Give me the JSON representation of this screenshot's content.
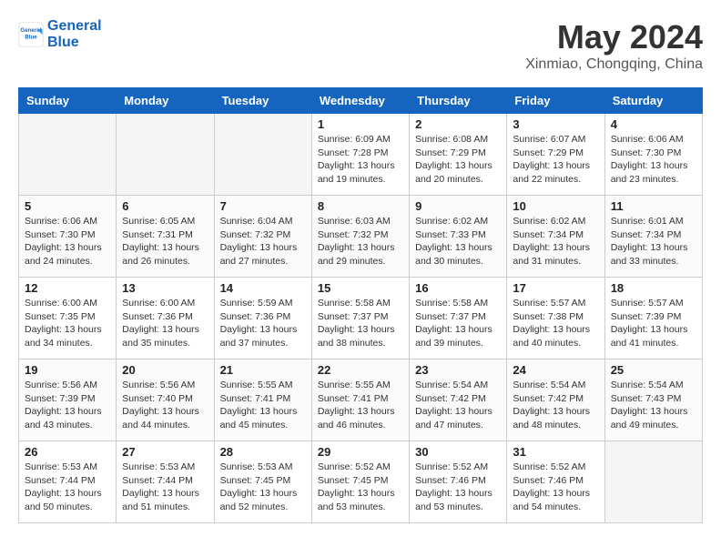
{
  "header": {
    "logo_line1": "General",
    "logo_line2": "Blue",
    "month": "May 2024",
    "location": "Xinmiao, Chongqing, China"
  },
  "weekdays": [
    "Sunday",
    "Monday",
    "Tuesday",
    "Wednesday",
    "Thursday",
    "Friday",
    "Saturday"
  ],
  "weeks": [
    [
      {
        "num": "",
        "detail": ""
      },
      {
        "num": "",
        "detail": ""
      },
      {
        "num": "",
        "detail": ""
      },
      {
        "num": "1",
        "detail": "Sunrise: 6:09 AM\nSunset: 7:28 PM\nDaylight: 13 hours\nand 19 minutes."
      },
      {
        "num": "2",
        "detail": "Sunrise: 6:08 AM\nSunset: 7:29 PM\nDaylight: 13 hours\nand 20 minutes."
      },
      {
        "num": "3",
        "detail": "Sunrise: 6:07 AM\nSunset: 7:29 PM\nDaylight: 13 hours\nand 22 minutes."
      },
      {
        "num": "4",
        "detail": "Sunrise: 6:06 AM\nSunset: 7:30 PM\nDaylight: 13 hours\nand 23 minutes."
      }
    ],
    [
      {
        "num": "5",
        "detail": "Sunrise: 6:06 AM\nSunset: 7:30 PM\nDaylight: 13 hours\nand 24 minutes."
      },
      {
        "num": "6",
        "detail": "Sunrise: 6:05 AM\nSunset: 7:31 PM\nDaylight: 13 hours\nand 26 minutes."
      },
      {
        "num": "7",
        "detail": "Sunrise: 6:04 AM\nSunset: 7:32 PM\nDaylight: 13 hours\nand 27 minutes."
      },
      {
        "num": "8",
        "detail": "Sunrise: 6:03 AM\nSunset: 7:32 PM\nDaylight: 13 hours\nand 29 minutes."
      },
      {
        "num": "9",
        "detail": "Sunrise: 6:02 AM\nSunset: 7:33 PM\nDaylight: 13 hours\nand 30 minutes."
      },
      {
        "num": "10",
        "detail": "Sunrise: 6:02 AM\nSunset: 7:34 PM\nDaylight: 13 hours\nand 31 minutes."
      },
      {
        "num": "11",
        "detail": "Sunrise: 6:01 AM\nSunset: 7:34 PM\nDaylight: 13 hours\nand 33 minutes."
      }
    ],
    [
      {
        "num": "12",
        "detail": "Sunrise: 6:00 AM\nSunset: 7:35 PM\nDaylight: 13 hours\nand 34 minutes."
      },
      {
        "num": "13",
        "detail": "Sunrise: 6:00 AM\nSunset: 7:36 PM\nDaylight: 13 hours\nand 35 minutes."
      },
      {
        "num": "14",
        "detail": "Sunrise: 5:59 AM\nSunset: 7:36 PM\nDaylight: 13 hours\nand 37 minutes."
      },
      {
        "num": "15",
        "detail": "Sunrise: 5:58 AM\nSunset: 7:37 PM\nDaylight: 13 hours\nand 38 minutes."
      },
      {
        "num": "16",
        "detail": "Sunrise: 5:58 AM\nSunset: 7:37 PM\nDaylight: 13 hours\nand 39 minutes."
      },
      {
        "num": "17",
        "detail": "Sunrise: 5:57 AM\nSunset: 7:38 PM\nDaylight: 13 hours\nand 40 minutes."
      },
      {
        "num": "18",
        "detail": "Sunrise: 5:57 AM\nSunset: 7:39 PM\nDaylight: 13 hours\nand 41 minutes."
      }
    ],
    [
      {
        "num": "19",
        "detail": "Sunrise: 5:56 AM\nSunset: 7:39 PM\nDaylight: 13 hours\nand 43 minutes."
      },
      {
        "num": "20",
        "detail": "Sunrise: 5:56 AM\nSunset: 7:40 PM\nDaylight: 13 hours\nand 44 minutes."
      },
      {
        "num": "21",
        "detail": "Sunrise: 5:55 AM\nSunset: 7:41 PM\nDaylight: 13 hours\nand 45 minutes."
      },
      {
        "num": "22",
        "detail": "Sunrise: 5:55 AM\nSunset: 7:41 PM\nDaylight: 13 hours\nand 46 minutes."
      },
      {
        "num": "23",
        "detail": "Sunrise: 5:54 AM\nSunset: 7:42 PM\nDaylight: 13 hours\nand 47 minutes."
      },
      {
        "num": "24",
        "detail": "Sunrise: 5:54 AM\nSunset: 7:42 PM\nDaylight: 13 hours\nand 48 minutes."
      },
      {
        "num": "25",
        "detail": "Sunrise: 5:54 AM\nSunset: 7:43 PM\nDaylight: 13 hours\nand 49 minutes."
      }
    ],
    [
      {
        "num": "26",
        "detail": "Sunrise: 5:53 AM\nSunset: 7:44 PM\nDaylight: 13 hours\nand 50 minutes."
      },
      {
        "num": "27",
        "detail": "Sunrise: 5:53 AM\nSunset: 7:44 PM\nDaylight: 13 hours\nand 51 minutes."
      },
      {
        "num": "28",
        "detail": "Sunrise: 5:53 AM\nSunset: 7:45 PM\nDaylight: 13 hours\nand 52 minutes."
      },
      {
        "num": "29",
        "detail": "Sunrise: 5:52 AM\nSunset: 7:45 PM\nDaylight: 13 hours\nand 53 minutes."
      },
      {
        "num": "30",
        "detail": "Sunrise: 5:52 AM\nSunset: 7:46 PM\nDaylight: 13 hours\nand 53 minutes."
      },
      {
        "num": "31",
        "detail": "Sunrise: 5:52 AM\nSunset: 7:46 PM\nDaylight: 13 hours\nand 54 minutes."
      },
      {
        "num": "",
        "detail": ""
      }
    ]
  ]
}
